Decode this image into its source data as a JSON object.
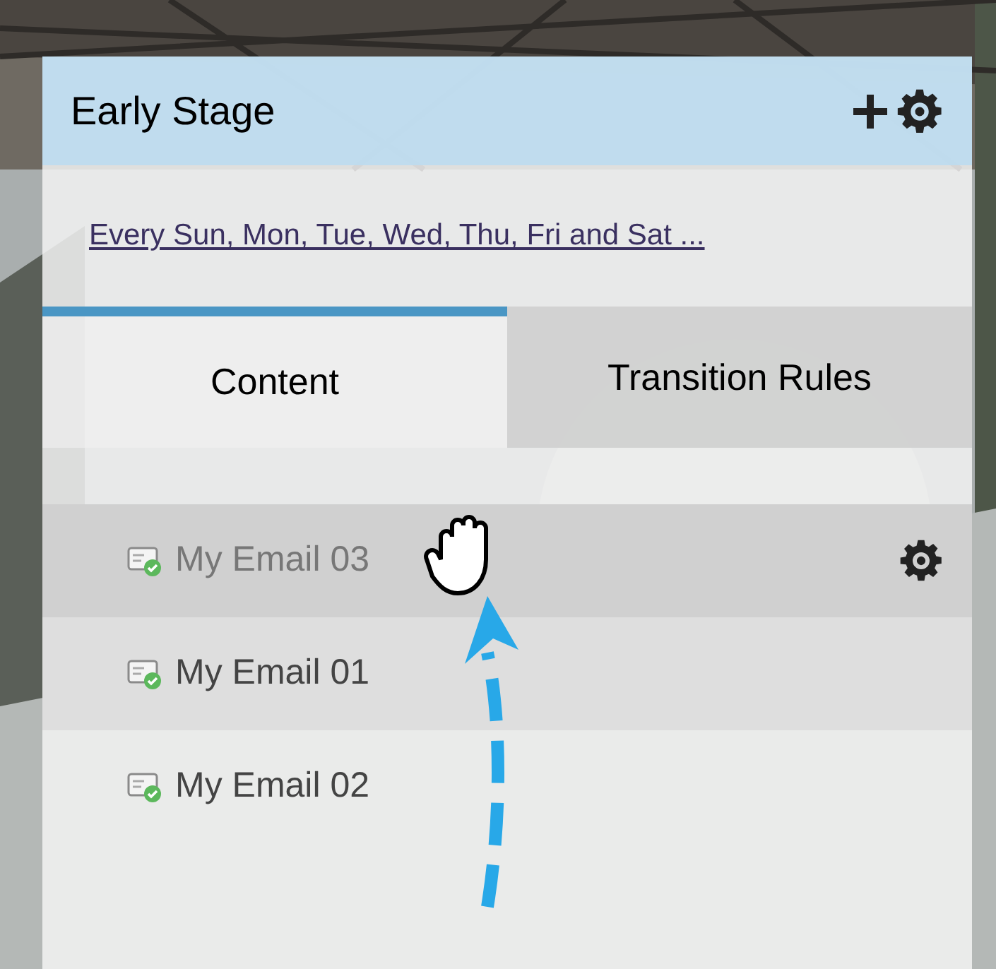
{
  "panel": {
    "title": "Early Stage",
    "schedule_link": "Every Sun, Mon, Tue, Wed, Thu, Fri and Sat ..."
  },
  "tabs": [
    {
      "label": "Content",
      "selected": true
    },
    {
      "label": "Transition Rules",
      "selected": false
    }
  ],
  "emails": [
    {
      "name": "My Email 03",
      "dragging": true,
      "highlighted": true
    },
    {
      "name": "My Email 01",
      "dragging": false,
      "highlighted": true
    },
    {
      "name": "My Email 02",
      "dragging": false,
      "highlighted": false
    }
  ]
}
